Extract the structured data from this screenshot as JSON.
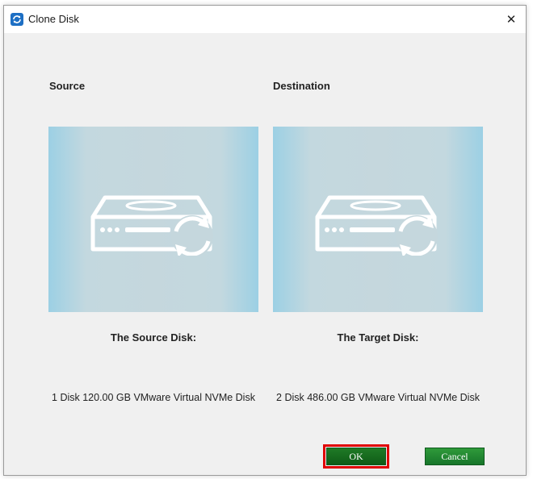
{
  "window": {
    "title": "Clone Disk",
    "close_glyph": "✕",
    "icon": "clone-disk-app-icon"
  },
  "source": {
    "label": "Source",
    "disk_title": "The Source Disk:",
    "disk_desc": "1 Disk 120.00 GB VMware Virtual NVMe Disk",
    "icon": "hard-disk-sync-icon"
  },
  "destination": {
    "label": "Destination",
    "disk_title": "The Target Disk:",
    "disk_desc": "2 Disk 486.00 GB VMware Virtual NVMe Disk",
    "icon": "hard-disk-sync-icon"
  },
  "buttons": {
    "ok_label": "OK",
    "cancel_label": "Cancel"
  },
  "colors": {
    "button_green": "#17762a",
    "highlight_red": "#e00000",
    "panel_blue": "#9cd0e4"
  }
}
